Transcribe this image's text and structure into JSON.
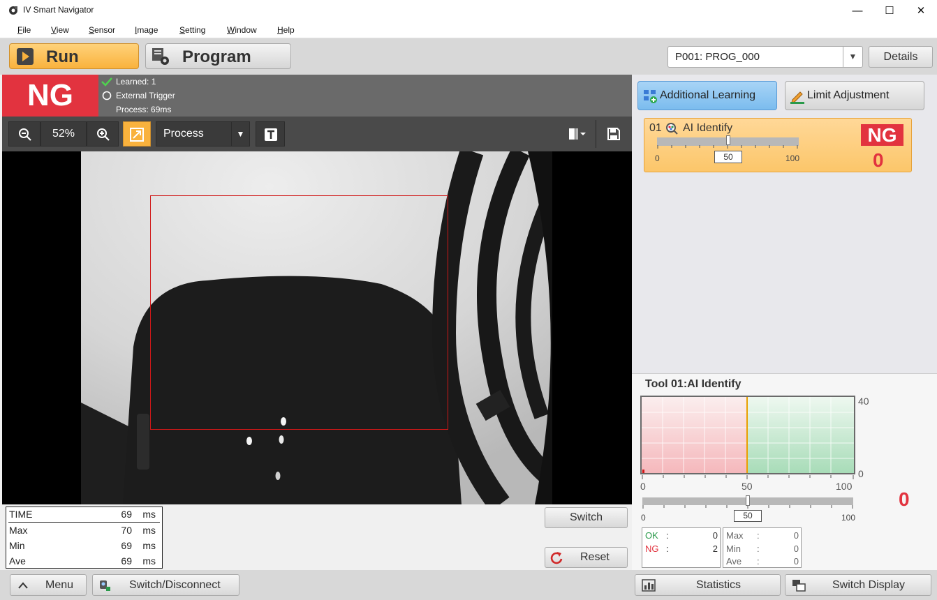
{
  "window": {
    "title": "IV Smart Navigator",
    "minimize": "—",
    "maximize": "☐",
    "close": "✕"
  },
  "menu": [
    {
      "label": "File",
      "key": "F",
      "rest": "ile"
    },
    {
      "label": "View",
      "key": "V",
      "rest": "iew"
    },
    {
      "label": "Sensor",
      "key": "S",
      "rest": "ensor"
    },
    {
      "label": "Image",
      "key": "I",
      "rest": "mage"
    },
    {
      "label": "Setting",
      "key": "S",
      "rest": "etting"
    },
    {
      "label": "Window",
      "key": "W",
      "rest": "indow"
    },
    {
      "label": "Help",
      "key": "H",
      "rest": "elp"
    }
  ],
  "toolbar": {
    "run_label": "Run",
    "program_label": "Program",
    "program_select": "P001: PROG_000",
    "details_label": "Details"
  },
  "status": {
    "result": "NG",
    "learned": "Learned: 1",
    "trigger": "External Trigger",
    "process": "Process: 69ms"
  },
  "view": {
    "zoom": "52%",
    "mode": "Process"
  },
  "timing": [
    {
      "label": "TIME",
      "value": "69",
      "unit": "ms"
    },
    {
      "label": "Max",
      "value": "70",
      "unit": "ms"
    },
    {
      "label": "Min",
      "value": "69",
      "unit": "ms"
    },
    {
      "label": "Ave",
      "value": "69",
      "unit": "ms"
    }
  ],
  "image_buttons": {
    "switch": "Switch",
    "reset": "Reset"
  },
  "right": {
    "additional_learning": "Additional Learning",
    "limit_adjustment": "Limit Adjustment",
    "tool": {
      "index": "01",
      "name": "AI Identify",
      "result": "NG",
      "value": "0",
      "slider_min": "0",
      "slider_value": "50",
      "slider_max": "100",
      "threshold": 50
    }
  },
  "detail": {
    "title": "Tool 01:AI Identify",
    "chart_y_max": "40",
    "chart_y_min": "0",
    "x_ticks": [
      "0",
      "50",
      "100"
    ],
    "slider_min": "0",
    "slider_value": "50",
    "slider_max": "100",
    "current_value": "0",
    "ok_label": "OK",
    "ok_count": "0",
    "ng_label": "NG",
    "ng_count": "2",
    "max_label": "Max",
    "max_value": "0",
    "min_label": "Min",
    "min_value": "0",
    "ave_label": "Ave",
    "ave_value": "0",
    "colon": ":"
  },
  "footer": {
    "menu": "Menu",
    "switch_disconnect": "Switch/Disconnect",
    "statistics": "Statistics",
    "switch_display": "Switch Display"
  },
  "colors": {
    "ng_red": "#e2333f",
    "run_orange": "#f9b23d",
    "ok_green": "#2a9a4a",
    "roi_red": "#d01818"
  }
}
